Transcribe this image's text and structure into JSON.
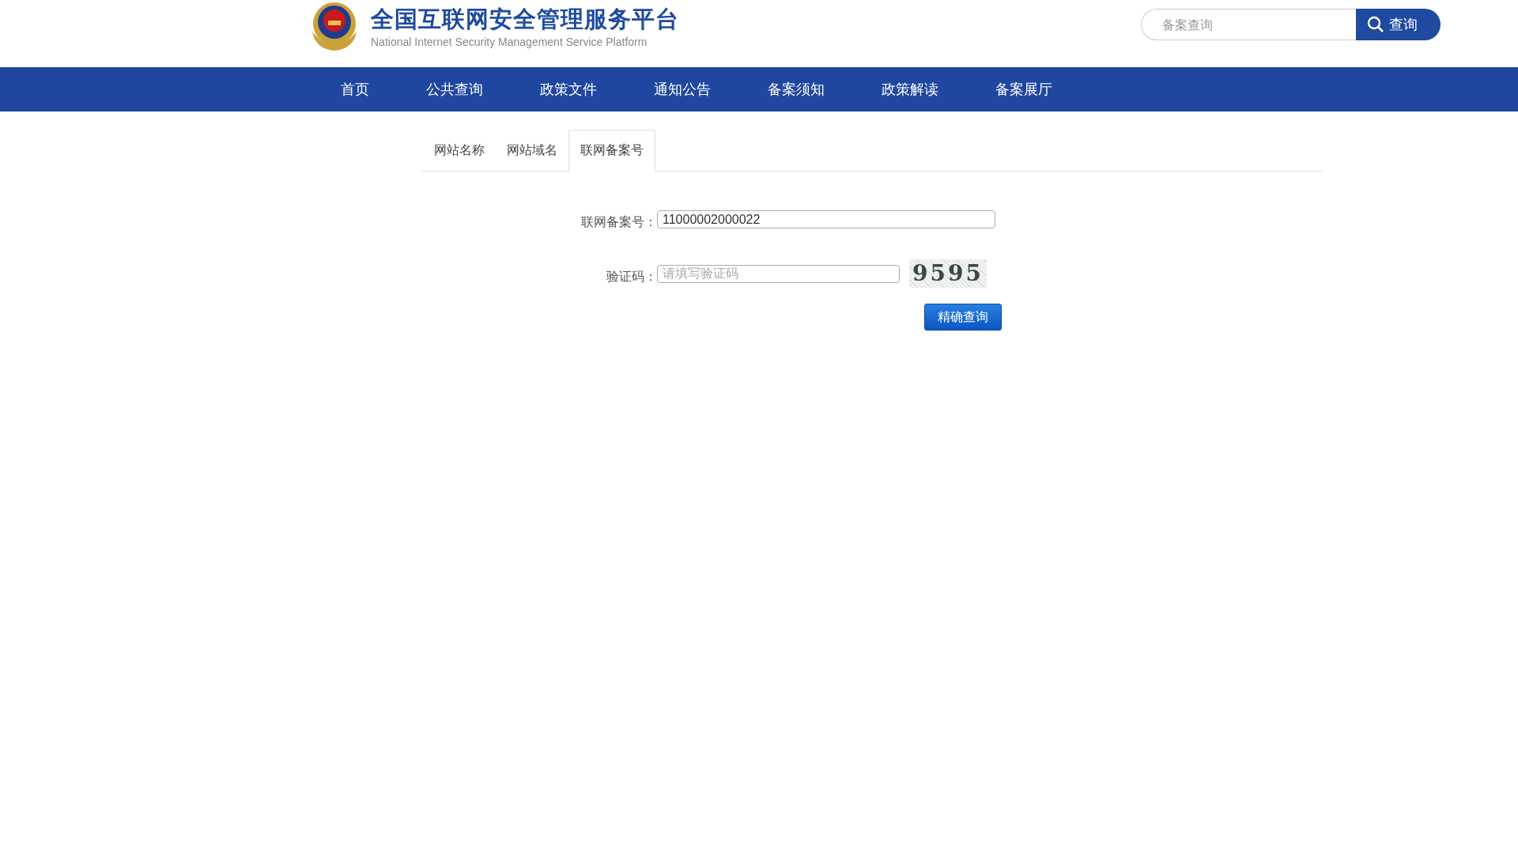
{
  "header": {
    "title": "全国互联网安全管理服务平台",
    "subtitle": "National Internet Security Management Service Platform",
    "search": {
      "placeholder": "备案查询",
      "button": "查询"
    }
  },
  "nav": [
    "首页",
    "公共查询",
    "政策文件",
    "通知公告",
    "备案须知",
    "政策解读",
    "备案展厅"
  ],
  "tabs": [
    {
      "label": "网站名称",
      "selected": false
    },
    {
      "label": "网站域名",
      "selected": false
    },
    {
      "label": "联网备案号",
      "selected": true
    }
  ],
  "form": {
    "record_label": "联网备案号：",
    "record_value": "11000002000022",
    "captcha_label": "验证码：",
    "captcha_placeholder": "请填写验证码",
    "captcha_code": "9595",
    "submit": "精确查询"
  }
}
